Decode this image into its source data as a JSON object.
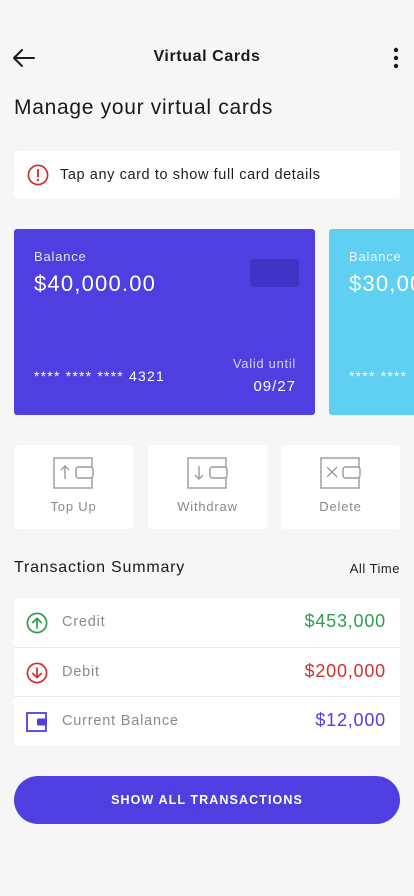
{
  "header": {
    "title": "Virtual Cards",
    "back_icon": "arrow-left-icon",
    "menu_icon": "more-vertical-icon"
  },
  "page": {
    "heading": "Manage your virtual cards"
  },
  "notice": {
    "text": "Tap any card to show full card details",
    "icon": "alert-circle-icon",
    "color": "#d32f2f"
  },
  "cards": [
    {
      "balance_label": "Balance",
      "balance": "$40,000.00",
      "number": "**** **** **** 4321",
      "valid_label": "Valid until",
      "valid_until": "09/27",
      "color": "#4f3fe0"
    },
    {
      "balance_label": "Balance",
      "balance": "$30,00",
      "number": "**** ****",
      "color": "#5fcff2"
    }
  ],
  "actions": [
    {
      "label": "Top Up",
      "icon": "top-up-icon"
    },
    {
      "label": "Withdraw",
      "icon": "withdraw-icon"
    },
    {
      "label": "Delete",
      "icon": "delete-card-icon"
    }
  ],
  "summary": {
    "title": "Transaction Summary",
    "period": "All Time",
    "rows": [
      {
        "label": "Credit",
        "amount": "$453,000",
        "color": "#2e9e4f",
        "icon": "arrow-up-circle-icon"
      },
      {
        "label": "Debit",
        "amount": "$200,000",
        "color": "#d32f2f",
        "icon": "arrow-down-circle-icon"
      },
      {
        "label": "Current Balance",
        "amount": "$12,000",
        "color": "#4f3fe0",
        "icon": "wallet-icon"
      }
    ]
  },
  "cta": {
    "label": "SHOW ALL TRANSACTIONS",
    "color": "#4f3fe0"
  }
}
